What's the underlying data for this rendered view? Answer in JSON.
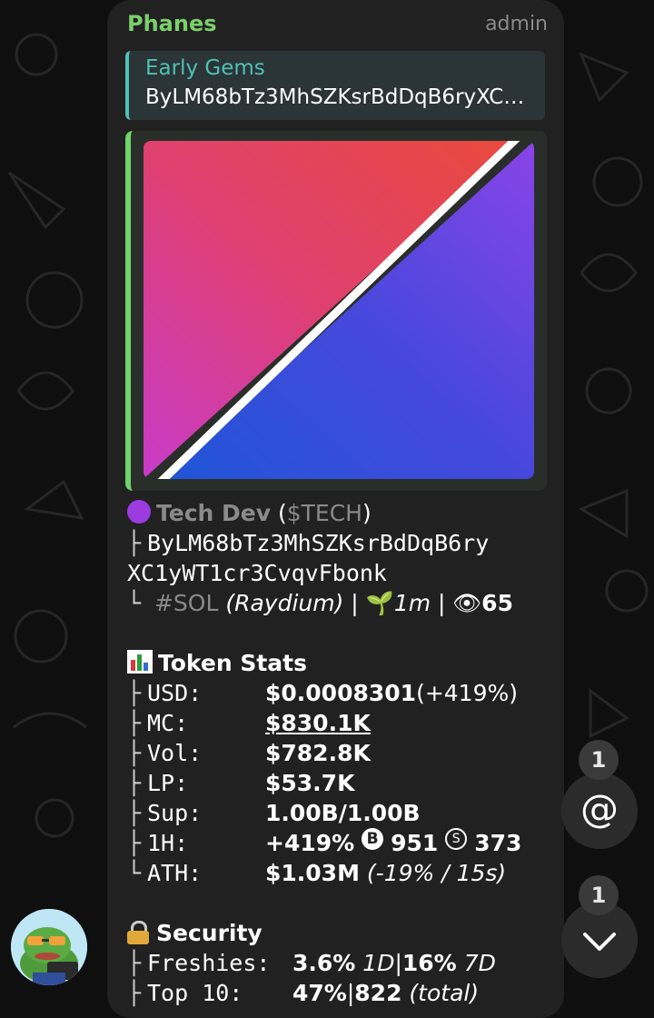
{
  "message": {
    "sender": "Phanes",
    "role": "admin",
    "reply": {
      "title": "Early Gems",
      "text": "ByLM68bTz3MhSZKsrBdDqB6ryXC…"
    },
    "token": {
      "name": "Tech Dev",
      "paren_open": " (",
      "ticker": "$TECH",
      "paren_close": ")",
      "address_line1": "ByLM68bTz3MhSZKsrBdDqB6ry",
      "address_line2": "XC1yWT1cr3CvqvFbonk",
      "chain": "#SOL",
      "dex": "(Raydium)",
      "sep": " | ",
      "age": "1m",
      "views": "65",
      "bullet_icon": "purple-circle",
      "age_icon": "seedling",
      "views_icon": "eye"
    },
    "token_stats": {
      "title": "Token Stats",
      "icon": "bar-chart",
      "usd": {
        "key": "USD:",
        "value": "$0.0008301",
        "change": " (+419%)"
      },
      "mc": {
        "key": "MC:",
        "value": "$830.1K"
      },
      "vol": {
        "key": "Vol:",
        "value": "$782.8K"
      },
      "lp": {
        "key": "LP:",
        "value": "$53.7K"
      },
      "sup": {
        "key": "Sup:",
        "value": "1.00B/1.00B"
      },
      "h1": {
        "key": "1H:",
        "change": "+419%",
        "buy_symbol": "B",
        "buys": "951",
        "sell_symbol": "S",
        "sells": "373"
      },
      "ath": {
        "key": "ATH:",
        "value": "$1.03M",
        "detail": "(-19% / 15s)"
      }
    },
    "security": {
      "title": "Security",
      "icon": "lock",
      "freshies": {
        "key": "Freshies:",
        "v1": "3.6%",
        "p1": "1D",
        "sep": " | ",
        "v2": "16%",
        "p2": "7D"
      },
      "top10": {
        "key": "Top 10:",
        "value": "47%",
        "sep": " | ",
        "count": "822",
        "detail": "(total)"
      }
    }
  },
  "badges": {
    "mentions": "1",
    "scroll": "1"
  },
  "colors": {
    "sender": "#7bcf6a",
    "reply_accent": "#4fc0b6",
    "preview_accent": "#6fd36a",
    "bubble": "#212121"
  }
}
